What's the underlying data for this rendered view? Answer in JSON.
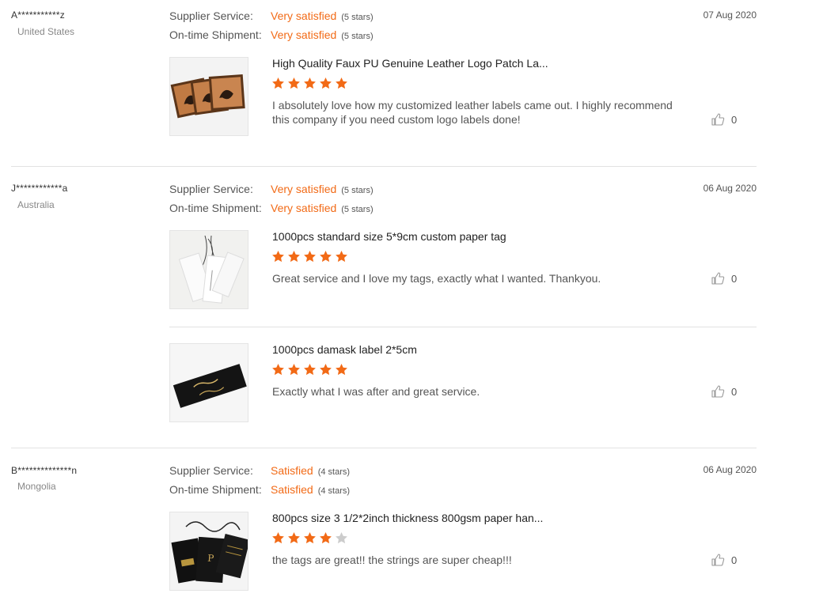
{
  "labels": {
    "supplier_service": "Supplier Service:",
    "ontime_shipment": "On-time Shipment:"
  },
  "colors": {
    "accent": "#f26a16",
    "star_empty": "#cccccc"
  },
  "reviews": [
    {
      "buyer": "A***********z",
      "country": "United States",
      "date": "07 Aug 2020",
      "supplier_rating": "Very satisfied",
      "supplier_stars": "(5 stars)",
      "shipment_rating": "Very satisfied",
      "shipment_stars": "(5 stars)",
      "products": [
        {
          "title": "High Quality Faux PU Genuine Leather Logo Patch La...",
          "rating": 5,
          "comment": "I absolutely love how my customized leather labels came out. I highly recommend this company if you need custom logo labels done!",
          "likes": "0",
          "image": "leather-patch-image"
        }
      ]
    },
    {
      "buyer": "J************a",
      "country": "Australia",
      "date": "06 Aug 2020",
      "supplier_rating": "Very satisfied",
      "supplier_stars": "(5 stars)",
      "shipment_rating": "Very satisfied",
      "shipment_stars": "(5 stars)",
      "products": [
        {
          "title": "1000pcs standard size 5*9cm custom paper tag",
          "rating": 5,
          "comment": "Great service and I love my tags, exactly what I wanted. Thankyou.",
          "likes": "0",
          "image": "paper-tag-image"
        },
        {
          "title": "1000pcs damask label 2*5cm",
          "rating": 5,
          "comment": "Exactly what I was after and great service.",
          "likes": "0",
          "image": "damask-label-image"
        }
      ]
    },
    {
      "buyer": "B**************n",
      "country": "Mongolia",
      "date": "06 Aug 2020",
      "supplier_rating": "Satisfied",
      "supplier_stars": "(4 stars)",
      "shipment_rating": "Satisfied",
      "shipment_stars": "(4 stars)",
      "products": [
        {
          "title": "800pcs size 3 1/2*2inch thickness 800gsm paper han...",
          "rating": 4,
          "comment": "the tags are great!! the strings are super cheap!!!",
          "likes": "0",
          "image": "hang-tag-image"
        }
      ]
    }
  ]
}
